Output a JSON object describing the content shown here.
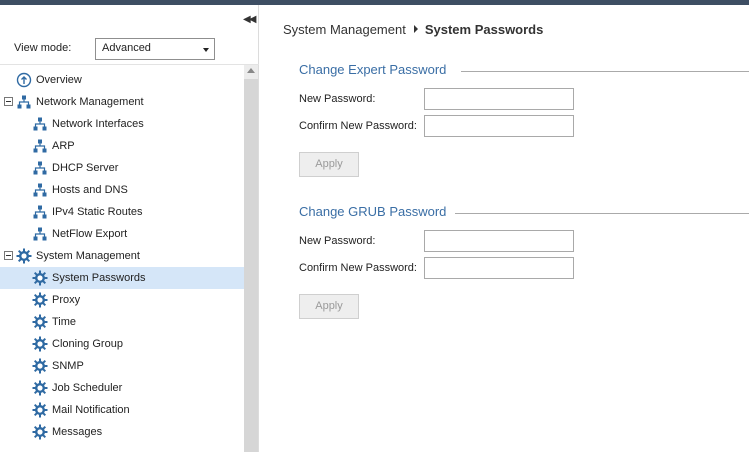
{
  "sidebar": {
    "collapse_icon": "double-chevron-left-icon",
    "view_mode_label": "View mode:",
    "view_mode_value": "Advanced",
    "tree": [
      {
        "label": "Overview",
        "icon": "overview-icon",
        "level": 0,
        "expander": false
      },
      {
        "label": "Network Management",
        "icon": "network-icon",
        "level": 0,
        "expander": true
      },
      {
        "label": "Network Interfaces",
        "icon": "network-icon",
        "level": 1,
        "expander": false
      },
      {
        "label": "ARP",
        "icon": "network-icon",
        "level": 1,
        "expander": false
      },
      {
        "label": "DHCP Server",
        "icon": "network-icon",
        "level": 1,
        "expander": false
      },
      {
        "label": "Hosts and DNS",
        "icon": "network-icon",
        "level": 1,
        "expander": false
      },
      {
        "label": "IPv4 Static Routes",
        "icon": "network-icon",
        "level": 1,
        "expander": false
      },
      {
        "label": "NetFlow Export",
        "icon": "network-icon",
        "level": 1,
        "expander": false
      },
      {
        "label": "System Management",
        "icon": "gear-icon",
        "level": 0,
        "expander": true
      },
      {
        "label": "System Passwords",
        "icon": "gear-icon",
        "level": 1,
        "expander": false,
        "selected": true
      },
      {
        "label": "Proxy",
        "icon": "gear-icon",
        "level": 1,
        "expander": false
      },
      {
        "label": "Time",
        "icon": "gear-icon",
        "level": 1,
        "expander": false
      },
      {
        "label": "Cloning Group",
        "icon": "gear-icon",
        "level": 1,
        "expander": false
      },
      {
        "label": "SNMP",
        "icon": "gear-icon",
        "level": 1,
        "expander": false
      },
      {
        "label": "Job Scheduler",
        "icon": "gear-icon",
        "level": 1,
        "expander": false
      },
      {
        "label": "Mail Notification",
        "icon": "gear-icon",
        "level": 1,
        "expander": false
      },
      {
        "label": "Messages",
        "icon": "gear-icon",
        "level": 1,
        "expander": false
      }
    ]
  },
  "breadcrumb": {
    "parent": "System Management",
    "current": "System Passwords"
  },
  "sections": [
    {
      "title": "Change Expert Password",
      "new_label": "New Password:",
      "confirm_label": "Confirm New Password:",
      "new_value": "",
      "confirm_value": "",
      "apply_label": "Apply"
    },
    {
      "title": "Change GRUB Password",
      "new_label": "New Password:",
      "confirm_label": "Confirm New Password:",
      "new_value": "",
      "confirm_value": "",
      "apply_label": "Apply"
    }
  ],
  "colors": {
    "topbar": "#3d4e63",
    "section_title": "#3a6ea5",
    "selected_row": "#d5e6f8",
    "icon_blue": "#2f6aa3"
  }
}
